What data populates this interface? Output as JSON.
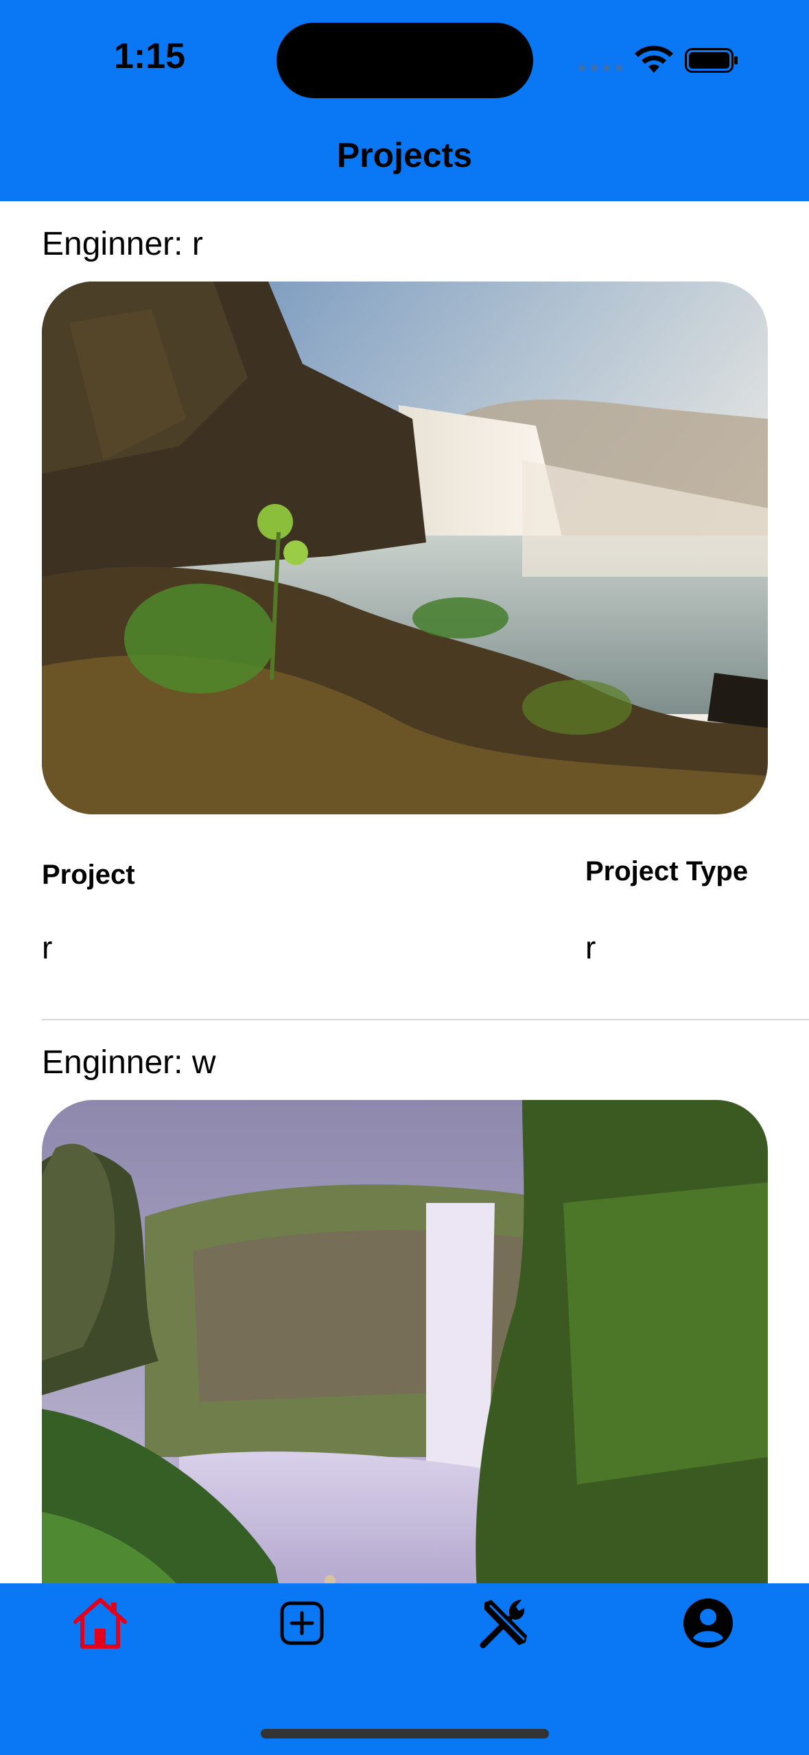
{
  "status_bar": {
    "time": "1:15"
  },
  "nav": {
    "title": "Projects"
  },
  "projects": [
    {
      "engineer": "Enginner: r",
      "project_label": "Project",
      "project_value": "r",
      "type_label": "Project Type",
      "type_value": "r",
      "image": "waterfall-coast-photo"
    },
    {
      "engineer": "Enginner: w",
      "image": "waterfall-canyon-photo"
    }
  ],
  "tab_bar": {
    "active_color": "#e3001b",
    "tabs": [
      {
        "name": "home-icon",
        "active": true
      },
      {
        "name": "plus-square-icon",
        "active": false
      },
      {
        "name": "tools-icon",
        "active": false
      },
      {
        "name": "profile-icon",
        "active": false
      }
    ]
  },
  "colors": {
    "brand_blue": "#0a78f5"
  }
}
